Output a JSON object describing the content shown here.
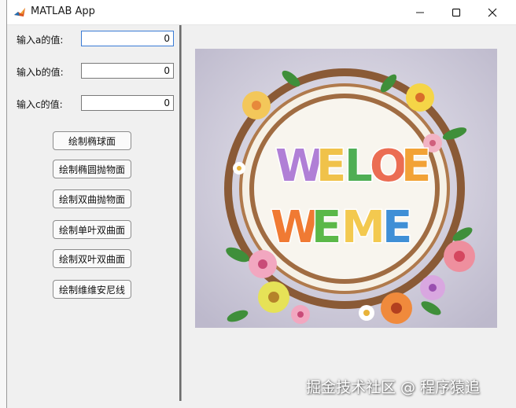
{
  "window": {
    "title": "MATLAB App",
    "icon": "matlab-icon"
  },
  "titlebar_buttons": {
    "minimize_icon": "minimize-icon",
    "maximize_icon": "maximize-icon",
    "close_icon": "close-icon"
  },
  "inputs": [
    {
      "label": "输入a的值:",
      "value": "0"
    },
    {
      "label": "输入b的值:",
      "value": "0"
    },
    {
      "label": "输入c的值:",
      "value": "0"
    }
  ],
  "buttons": [
    {
      "label": "绘制椭球面"
    },
    {
      "label": "绘制椭圆抛物面"
    },
    {
      "label": "绘制双曲抛物面"
    },
    {
      "label": "绘制单叶双曲面"
    },
    {
      "label": "绘制双叶双曲面"
    },
    {
      "label": "绘制维维安尼线"
    }
  ],
  "image": {
    "line1": "WELOE",
    "line2": "WEME"
  },
  "watermark": "掘金技术社区 @ 程序猿追",
  "colors": {
    "window_bg": "#f0f0f0",
    "input_focus": "#3a7bd5"
  }
}
